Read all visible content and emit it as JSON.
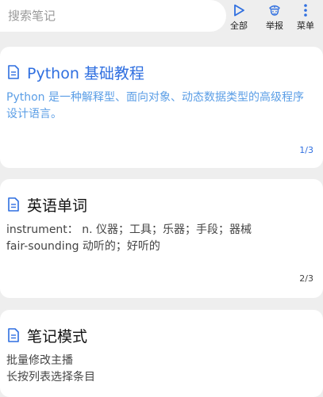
{
  "search": {
    "placeholder": "搜索笔记"
  },
  "toolbar": {
    "all_label": "全部",
    "report_label": "举报",
    "menu_label": "菜单",
    "icons": {
      "all": "play-triangle-icon",
      "report": "police-officer-icon",
      "menu": "vertical-dots-icon"
    }
  },
  "colors": {
    "accent": "#2f6fe0",
    "accent_light": "#5b9ee6",
    "background": "#eeeeee",
    "card": "#ffffff"
  },
  "notes": [
    {
      "title": "Python 基础教程",
      "lines": [
        "Python 是一种解释型、面向对象、动态数据类型的高级程序设计语言。"
      ],
      "page": "1/3",
      "icon": "document-icon",
      "active": true
    },
    {
      "title": "英语单词",
      "lines": [
        "instrument： n. 仪器；工具；乐器；手段；器械",
        "fair-sounding 动听的；好听的"
      ],
      "page": "2/3",
      "icon": "document-icon",
      "active": false
    },
    {
      "title": "笔记模式",
      "lines": [
        "批量修改主播",
        "长按列表选择条目"
      ],
      "page": "",
      "icon": "document-icon",
      "active": false
    }
  ]
}
